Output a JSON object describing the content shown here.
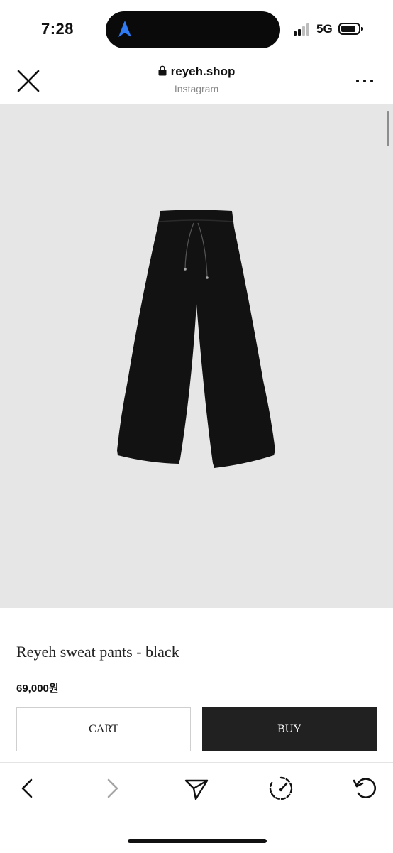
{
  "status_bar": {
    "time": "7:28",
    "network": "5G",
    "location_icon": "navigation-arrow-icon",
    "accent_color": "#2f7bf5"
  },
  "browser": {
    "url": "reyeh.shop",
    "source": "Instagram",
    "icons": [
      "close-icon",
      "lock-icon",
      "more-icon"
    ]
  },
  "product": {
    "image_description_icon": "black-sweat-pants-image",
    "image_background": "#e6e6e6",
    "title": "Reyeh sweat pants - black",
    "price": "69,000원"
  },
  "actions": {
    "cart_label": "CART",
    "buy_label": "BUY",
    "buy_color": "#212121"
  },
  "bottom_nav": {
    "icons": [
      "back-icon",
      "forward-icon",
      "share-icon",
      "speed-icon",
      "reload-icon"
    ]
  }
}
